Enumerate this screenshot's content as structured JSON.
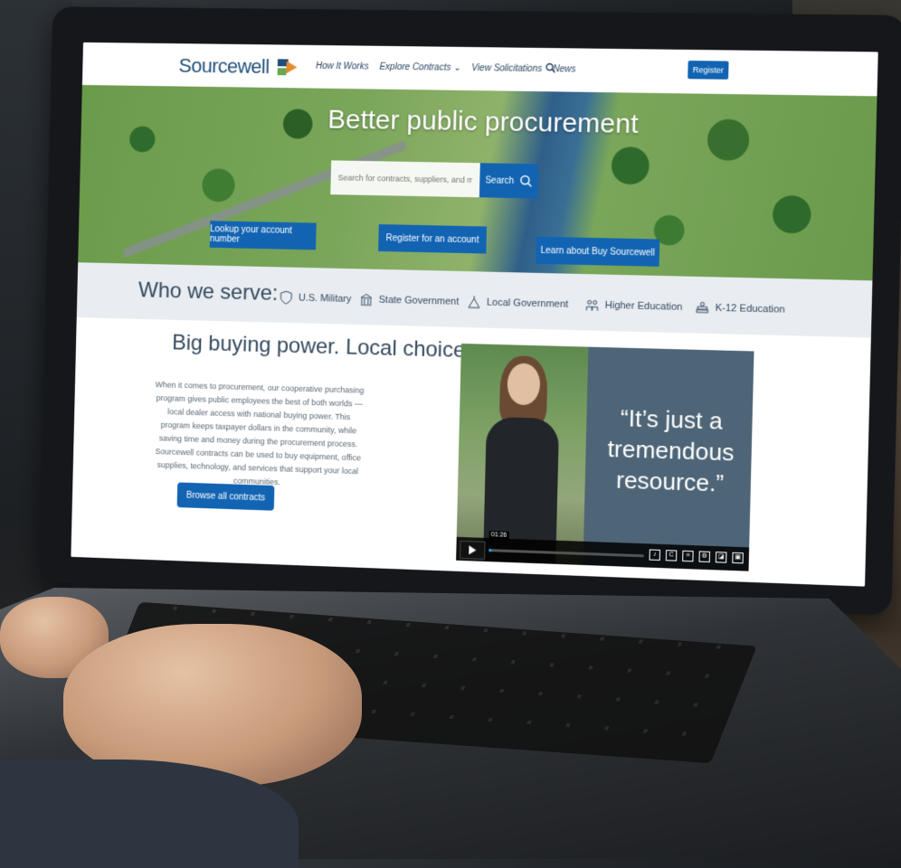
{
  "site": {
    "logo_text": "Sourcewell",
    "nav": [
      "How It Works",
      "Explore Contracts",
      "View Solicitations",
      "News"
    ],
    "register_label": "Register"
  },
  "hero": {
    "title": "Better public procurement",
    "search_placeholder": "Search for contracts, suppliers, and more",
    "search_button": "Search",
    "ctas": [
      "Lookup your account number",
      "Register for an account",
      "Learn about Buy Sourcewell"
    ]
  },
  "who_we_serve": {
    "label": "Who we serve:",
    "items": [
      "U.S. Military",
      "State Government",
      "Local Government",
      "Higher Education",
      "K-12 Education"
    ]
  },
  "content": {
    "title": "Big buying power. Local choice.",
    "body": "When it comes to procurement, our cooperative purchasing program gives public employees the best of both worlds — local dealer access with national buying power. This program keeps taxpayer dollars in the community, while saving time and money during the procurement process. Sourcewell contracts can be used to buy equipment, office supplies, technology, and services that support your local communities.",
    "browse_button": "Browse all contracts"
  },
  "video": {
    "quote": "“It’s just a tremendous resource.”",
    "timecode": "01:26",
    "progress": 0.02
  },
  "colors": {
    "brand_blue": "#1264b2",
    "accent_orange": "#e58b2a",
    "text_dark": "#34495e"
  }
}
